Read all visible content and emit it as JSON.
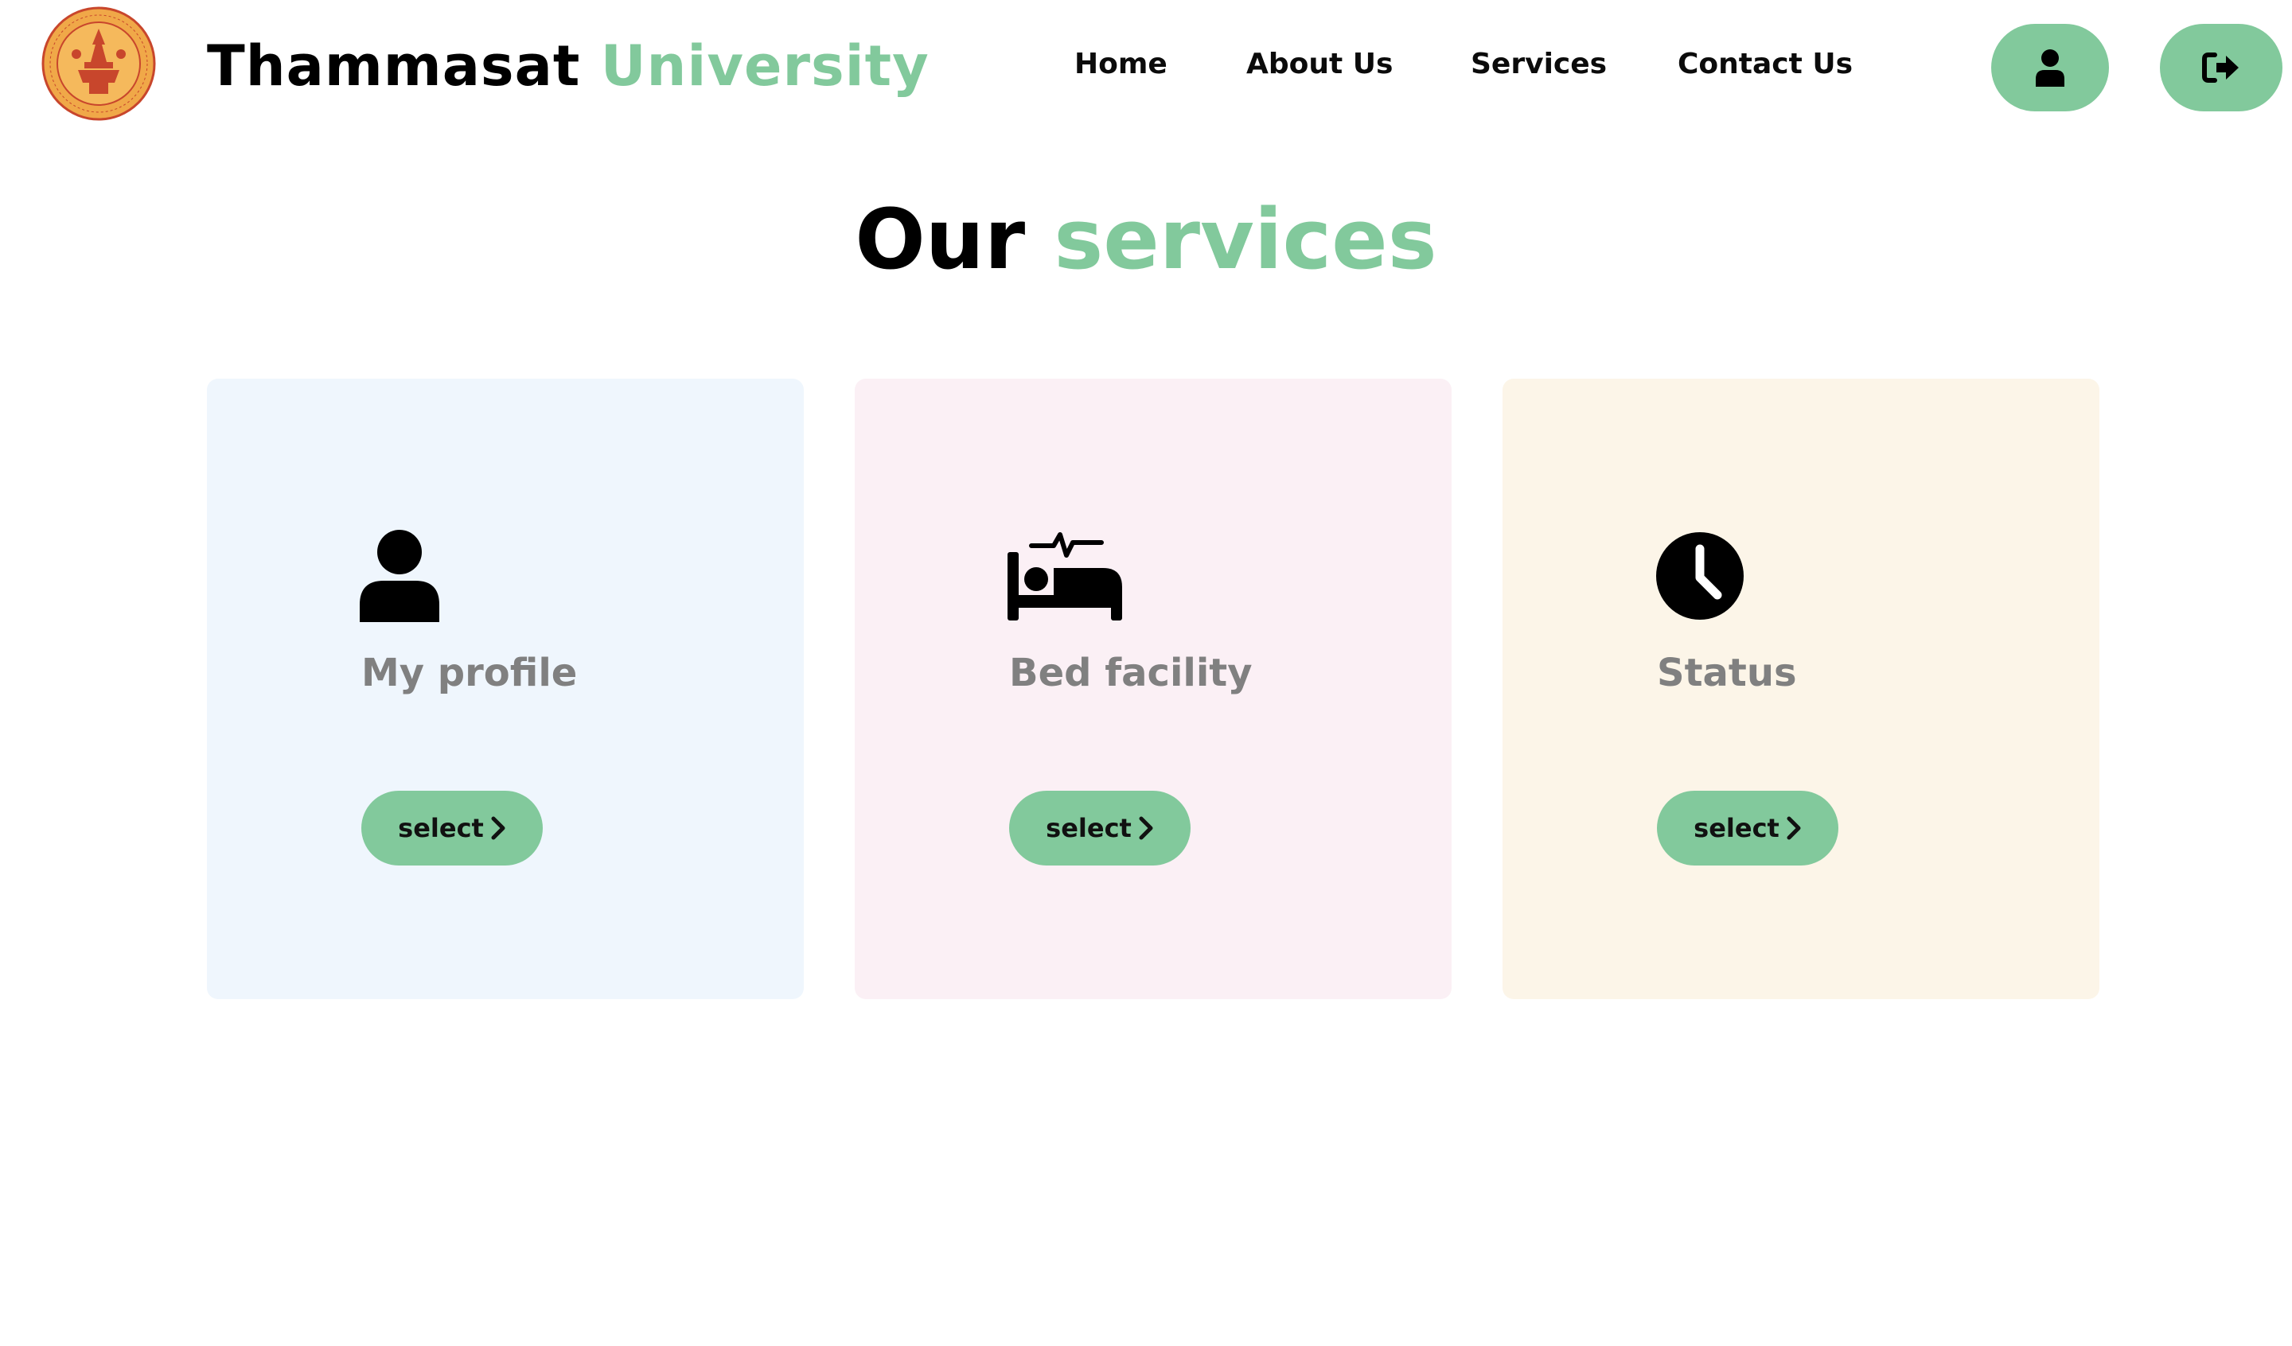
{
  "header": {
    "brand_main": "Thammasat",
    "brand_accent": "University",
    "logo_icon": "thammasat-university-seal",
    "nav": {
      "home": "Home",
      "about": "About Us",
      "services": "Services",
      "contact": "Contact Us"
    },
    "profile_icon": "user-icon",
    "logout_icon": "sign-out-icon"
  },
  "main": {
    "title_main": "Our",
    "title_accent": "services",
    "cards": [
      {
        "icon": "user-icon",
        "label": "My profile",
        "button_label": "select"
      },
      {
        "icon": "bed-pulse-icon",
        "label": "Bed facility",
        "button_label": "select"
      },
      {
        "icon": "clock-icon",
        "label": "Status",
        "button_label": "select"
      }
    ]
  },
  "colors": {
    "accent": "#82c99c",
    "card_profile_bg": "#eff6fd",
    "card_bed_bg": "#fbf0f5",
    "card_status_bg": "#fcf5e8",
    "label_gray": "#808080",
    "logo_orange": "#f0a848",
    "logo_red": "#c8462c"
  }
}
